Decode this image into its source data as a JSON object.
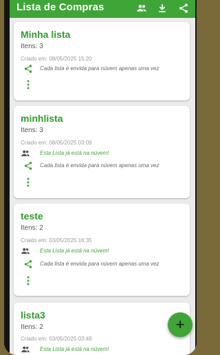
{
  "appbar": {
    "title": "Lista de Compras",
    "actions": [
      "group-icon",
      "download-icon",
      "share-icon"
    ]
  },
  "colors": {
    "primary": "#3fa536",
    "title_green": "#2e9c2a",
    "background": "#ebebeb"
  },
  "lists": [
    {
      "name": "Minha lista",
      "items": "Itens: 3",
      "created": "Criado em: 08/05/2025 15:20",
      "cloud_status": "",
      "share_note": "Cada lista é envida para núvem apenas uma vez"
    },
    {
      "name": "minhlista",
      "items": "Itens: 3",
      "created": "Criado em: 08/05/2025 03:09",
      "cloud_status": "Esta Lista já está na núvem!",
      "share_note": "Cada lista é envida para núvem apenas uma vez"
    },
    {
      "name": "teste",
      "items": "Itens: 2",
      "created": "Criado em: 03/05/2025 16:35",
      "cloud_status": "Esta Lista já está na núvem!",
      "share_note": "Cada lista é envida para núvem apenas uma vez"
    },
    {
      "name": "lista3",
      "items": "Itens: 2",
      "created": "Criado em: 03/05/2025 03:48",
      "cloud_status": "Esta Lista já está na núvem!",
      "share_note": ""
    }
  ],
  "fab": {
    "label": "+"
  }
}
